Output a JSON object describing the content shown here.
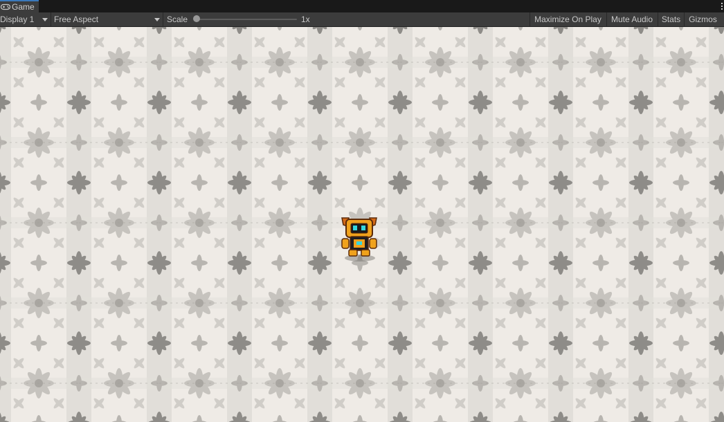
{
  "tab": {
    "title": "Game",
    "icon": "gamepad-icon"
  },
  "toolbar": {
    "display": "Display 1",
    "aspect": "Free Aspect",
    "scale_label": "Scale",
    "scale_value": "1x",
    "scale_slider_level": 0.0,
    "maximize_on_play": "Maximize On Play",
    "mute_audio": "Mute Audio",
    "stats": "Stats",
    "gizmos": "Gizmos"
  },
  "colors": {
    "tab_accent": "#3a79bb",
    "toolbar_bg": "#3c3c3c",
    "text": "#c8c8c8",
    "floor_light": "#f3f0ec",
    "floor_mid": "#c9c6c1",
    "floor_dark": "#8a8884",
    "robot_orange": "#f0a21c",
    "robot_visor": "#35d7de"
  },
  "scene": {
    "character": "robot-player-sprite",
    "background": "floral-tile-floor"
  }
}
